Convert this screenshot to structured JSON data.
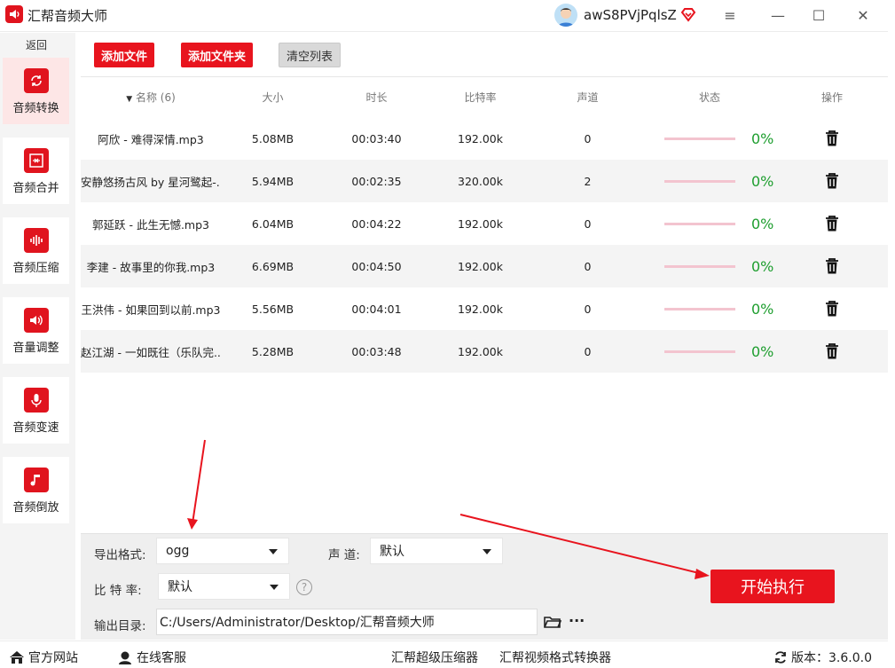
{
  "app": {
    "title": "汇帮音频大师",
    "username": "awS8PVjPqlsZ"
  },
  "window_controls": {
    "menu": "≡",
    "minimize": "—",
    "maximize": "☐",
    "close": "✕"
  },
  "sidebar": {
    "back_label": "返回",
    "items": [
      {
        "label": "音频转换",
        "icon": "convert-icon"
      },
      {
        "label": "音频合并",
        "icon": "merge-icon"
      },
      {
        "label": "音频压缩",
        "icon": "compress-icon"
      },
      {
        "label": "音量调整",
        "icon": "volume-icon"
      },
      {
        "label": "音频变速",
        "icon": "microphone-icon"
      },
      {
        "label": "音频倒放",
        "icon": "music-note-icon"
      }
    ]
  },
  "toolbar": {
    "add_file": "添加文件",
    "add_folder": "添加文件夹",
    "clear_list": "清空列表"
  },
  "table": {
    "headers": {
      "name": "名称 (6)",
      "size": "大小",
      "duration": "时长",
      "bitrate": "比特率",
      "channels": "声道",
      "status": "状态",
      "actions": "操作"
    },
    "rows": [
      {
        "name": "阿欣 - 难得深情.mp3",
        "size": "5.08MB",
        "duration": "00:03:40",
        "bitrate": "192.00k",
        "channels": "0",
        "progress": "0%"
      },
      {
        "name": "安静悠扬古风 by 星河鹭起-...",
        "size": "5.94MB",
        "duration": "00:02:35",
        "bitrate": "320.00k",
        "channels": "2",
        "progress": "0%"
      },
      {
        "name": "郭延跃 - 此生无憾.mp3",
        "size": "6.04MB",
        "duration": "00:04:22",
        "bitrate": "192.00k",
        "channels": "0",
        "progress": "0%"
      },
      {
        "name": "李建 - 故事里的你我.mp3",
        "size": "6.69MB",
        "duration": "00:04:50",
        "bitrate": "192.00k",
        "channels": "0",
        "progress": "0%"
      },
      {
        "name": "王洪伟 - 如果回到以前.mp3",
        "size": "5.56MB",
        "duration": "00:04:01",
        "bitrate": "192.00k",
        "channels": "0",
        "progress": "0%"
      },
      {
        "name": "赵江湖 - 一如既往（乐队完...",
        "size": "5.28MB",
        "duration": "00:03:48",
        "bitrate": "192.00k",
        "channels": "0",
        "progress": "0%"
      }
    ]
  },
  "settings": {
    "format_label": "导出格式:",
    "format_value": "ogg",
    "channel_label": "声 道:",
    "channel_value": "默认",
    "bitrate_label": "比 特 率:",
    "bitrate_value": "默认",
    "help": "?",
    "output_label": "输出目录:",
    "output_path": "C:/Users/Administrator/Desktop/汇帮音频大师",
    "more": "···"
  },
  "start_button": "开始执行",
  "footer": {
    "website": "官方网站",
    "support": "在线客服",
    "compressor": "汇帮超级压缩器",
    "video_converter": "汇帮视频格式转换器",
    "version": "版本：3.6.0.0"
  },
  "colors": {
    "accent": "#e8141e",
    "progress_text": "#1e9e2f",
    "progress_track": "#f3c4cf"
  }
}
